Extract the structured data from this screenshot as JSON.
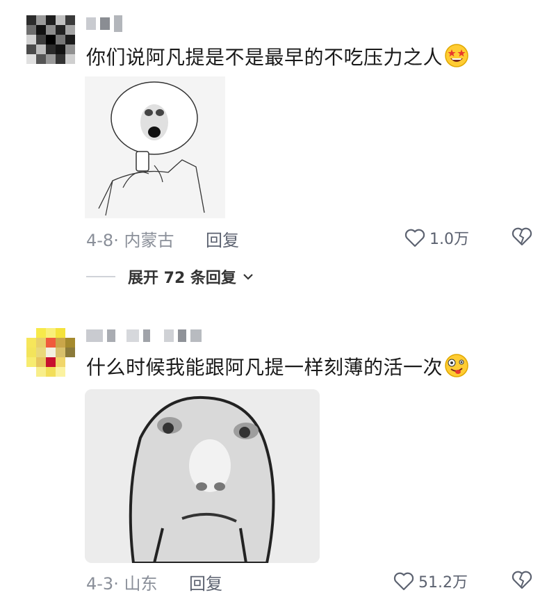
{
  "comments": [
    {
      "text": "你们说阿凡提是不是最早的不吃压力之人",
      "emoji": "star-struck-emoji",
      "media": "meme-boy-phone-bed",
      "date": "4-8",
      "location": "· 内蒙古",
      "reply_label": "回复",
      "like_count": "1.0万",
      "expand_label": "展开 72 条回复"
    },
    {
      "text": "什么时候我能跟阿凡提一样刻薄的活一次",
      "emoji": "zany-face-emoji",
      "media": "meme-face-close-up",
      "date": "4-3",
      "location": "· 山东",
      "reply_label": "回复",
      "like_count": "51.2万"
    }
  ],
  "colors": {
    "meta_text": "#8a8f99",
    "action_text": "#5c6270",
    "blurred_name": "#c9cbd0"
  },
  "icons": [
    "heart-outline-icon",
    "broken-heart-icon",
    "chevron-down-icon"
  ]
}
